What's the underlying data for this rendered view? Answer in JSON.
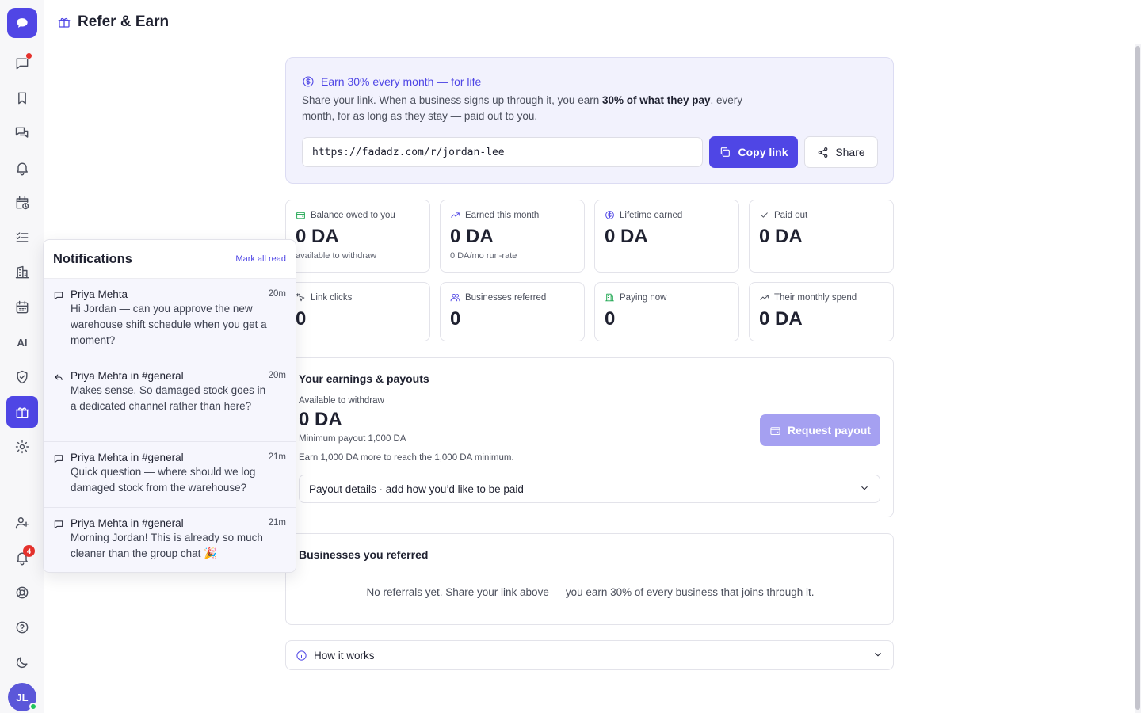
{
  "header": {
    "title": "Refer & Earn"
  },
  "sidebar": {
    "ai_label": "AI",
    "bell_badge": "4",
    "avatar_initials": "JL"
  },
  "hero": {
    "title": "Earn 30% every month — for life",
    "desc_before": "Share your link. When a business signs up through it, you earn ",
    "desc_bold": "30% of what they pay",
    "desc_after": ", every month, for as long as they stay — paid out to you.",
    "link": "https://fadadz.com/r/jordan-lee",
    "copy_label": "Copy link",
    "share_label": "Share"
  },
  "stats": [
    {
      "label": "Balance owed to you",
      "value": "0 DA",
      "sub": "available to withdraw"
    },
    {
      "label": "Earned this month",
      "value": "0 DA",
      "sub": "0 DA/mo run-rate"
    },
    {
      "label": "Lifetime earned",
      "value": "0 DA"
    },
    {
      "label": "Paid out",
      "value": "0 DA"
    },
    {
      "label": "Link clicks",
      "value": "0"
    },
    {
      "label": "Businesses referred",
      "value": "0"
    },
    {
      "label": "Paying now",
      "value": "0"
    },
    {
      "label": "Their monthly spend",
      "value": "0 DA"
    }
  ],
  "earnings": {
    "title": "Your earnings & payouts",
    "available_label": "Available to withdraw",
    "available_value": "0 DA",
    "minimum": "Minimum payout 1,000 DA",
    "note": "Earn 1,000 DA more to reach the 1,000 DA minimum.",
    "payout_button": "Request payout",
    "payout_details": "Payout details · add how you’d like to be paid"
  },
  "referred": {
    "title": "Businesses you referred",
    "empty": "No referrals yet. Share your link above — you earn 30% of every business that joins through it."
  },
  "how_it_works": "How it works",
  "notifications": {
    "title": "Notifications",
    "mark_all": "Mark all read",
    "items": [
      {
        "name": "Priya Mehta",
        "time": "20m",
        "text": "Hi Jordan — can you approve the new warehouse shift schedule when you get a moment?",
        "icon": "message-icon"
      },
      {
        "name": "Priya Mehta in #general",
        "time": "20m",
        "text": "Makes sense. So damaged stock goes in a dedicated channel rather than here?",
        "icon": "reply-icon"
      },
      {
        "name": "Priya Mehta in #general",
        "time": "21m",
        "text": "Quick question — where should we log damaged stock from the warehouse?",
        "icon": "message-icon"
      },
      {
        "name": "Priya Mehta in #general",
        "time": "21m",
        "text": "Morning Jordan! This is already so much cleaner than the group chat 🎉",
        "icon": "message-icon"
      }
    ]
  },
  "colors": {
    "accent": "#4f46e5",
    "badge": "#e5322d",
    "online": "#22c55e"
  }
}
